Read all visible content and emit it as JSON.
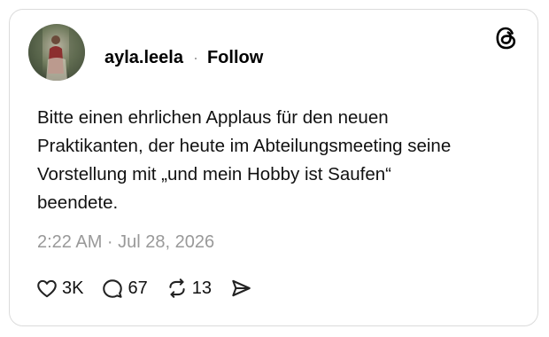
{
  "post": {
    "username": "ayla.leela",
    "separator": "·",
    "follow_label": "Follow",
    "text": "Bitte einen ehrlichen Applaus für den neuen\nPraktikanten, der heute im Abteilungsmeeting seine\nVorstellung mit „und mein Hobby ist Saufen“\nbeendete.",
    "timestamp": "2:22 AM · Jul 28, 2026"
  },
  "actions": {
    "likes": "3K",
    "replies": "67",
    "reposts": "13"
  },
  "icons": {
    "logo": "threads-logo-icon",
    "like": "heart-icon",
    "reply": "speech-bubble-icon",
    "repost": "repost-icon",
    "share": "send-icon"
  }
}
